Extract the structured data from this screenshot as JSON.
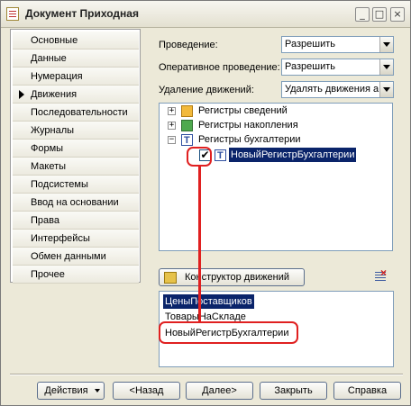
{
  "window": {
    "title": "Документ Приходная"
  },
  "nav": {
    "items": [
      {
        "label": "Основные"
      },
      {
        "label": "Данные"
      },
      {
        "label": "Нумерация"
      },
      {
        "label": "Движения",
        "active": true
      },
      {
        "label": "Последовательности"
      },
      {
        "label": "Журналы"
      },
      {
        "label": "Формы"
      },
      {
        "label": "Макеты"
      },
      {
        "label": "Подсистемы"
      },
      {
        "label": "Ввод на основании"
      },
      {
        "label": "Права"
      },
      {
        "label": "Интерфейсы"
      },
      {
        "label": "Обмен данными"
      },
      {
        "label": "Прочее"
      }
    ]
  },
  "form": {
    "provedenie_label": "Проведение:",
    "provedenie_value": "Разрешить",
    "oper_label": "Оперативное проведение:",
    "oper_value": "Разрешить",
    "udalenie_label": "Удаление движений:",
    "udalenie_value": "Удалять движения а"
  },
  "tree": {
    "nodes": [
      {
        "label": "Регистры сведений",
        "expander": "+"
      },
      {
        "label": "Регистры накопления",
        "expander": "+"
      },
      {
        "label": "Регистры бухгалтерии",
        "expander": "−"
      },
      {
        "label": "НовыйРегистрБухгалтерии",
        "checked": true,
        "selected": true
      }
    ]
  },
  "toolbar": {
    "konstruktor_label": "Конструктор движений"
  },
  "list": {
    "items": [
      {
        "label": "ЦеныПоставщиков",
        "selected": true
      },
      {
        "label": "ТоварыНаСкладе"
      },
      {
        "label": "НовыйРегистрБухгалтерии"
      }
    ]
  },
  "footer": {
    "actions_label": "Действия",
    "back_label": "<Назад",
    "next_label": "Далее>",
    "close_label": "Закрыть",
    "help_label": "Справка"
  },
  "colors": {
    "highlight": "#e02020",
    "selection": "#0a246a",
    "window_bg": "#ece9d8"
  }
}
